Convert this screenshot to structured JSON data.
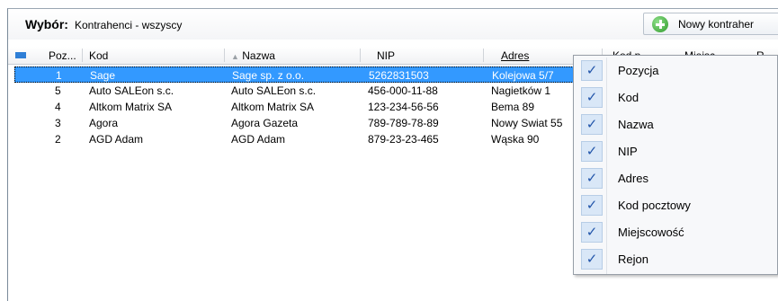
{
  "toolbar": {
    "filter_label": "Wybór:",
    "filter_value": "Kontrahenci - wszyscy",
    "new_button_label": "Nowy kontraher"
  },
  "table": {
    "columns": [
      "Poz...",
      "Kod",
      "Nazwa",
      "NIP",
      "Adres",
      "Kod p",
      "Miejsc",
      "R"
    ],
    "sort_indicator": "▲",
    "rows": [
      {
        "poz": "1",
        "kod": "Sage",
        "nazwa": "Sage sp. z o.o.",
        "nip": "5262831503",
        "adres": "Kolejowa 5/7"
      },
      {
        "poz": "5",
        "kod": "Auto SALEon s.c.",
        "nazwa": "Auto SALEon s.c.",
        "nip": "456-000-11-88",
        "adres": "Nagietków 1"
      },
      {
        "poz": "4",
        "kod": "Altkom Matrix SA",
        "nazwa": "Altkom Matrix SA",
        "nip": "123-234-56-56",
        "adres": "Bema 89"
      },
      {
        "poz": "3",
        "kod": "Agora",
        "nazwa": "Agora Gazeta",
        "nip": "789-789-78-89",
        "adres": "Nowy Swiat 55"
      },
      {
        "poz": "2",
        "kod": "AGD Adam",
        "nazwa": "AGD Adam",
        "nip": "879-23-23-465",
        "adres": "Wąska 90"
      }
    ]
  },
  "column_menu": {
    "items": [
      {
        "label": "Pozycja",
        "checked": true
      },
      {
        "label": "Kod",
        "checked": true
      },
      {
        "label": "Nazwa",
        "checked": true
      },
      {
        "label": "NIP",
        "checked": true
      },
      {
        "label": "Adres",
        "checked": true
      },
      {
        "label": "Kod pocztowy",
        "checked": true
      },
      {
        "label": "Miejscowość",
        "checked": true
      },
      {
        "label": "Rejon",
        "checked": true
      }
    ],
    "check_glyph": "✓"
  },
  "colors": {
    "selection": "#3399ff",
    "accent": "#2f7fd6",
    "add_icon": "#2f9a2b"
  }
}
